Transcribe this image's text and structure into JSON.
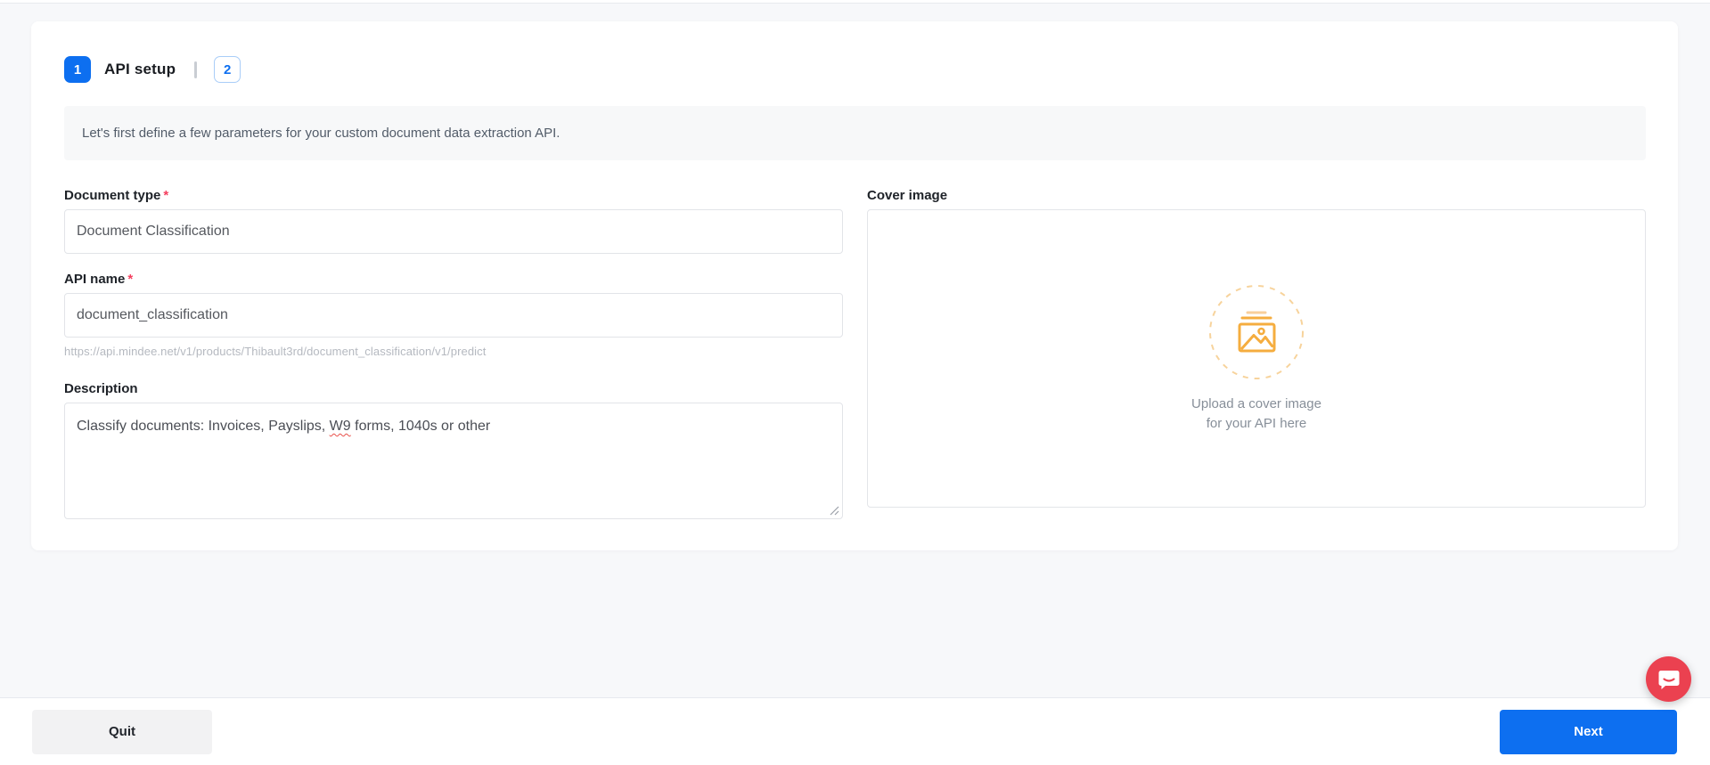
{
  "colors": {
    "accent_blue": "#0d6ff0",
    "step2_border_blue": "#a9cdf8",
    "required_red": "#f43f5e",
    "chat_red": "#eb4150",
    "upload_icon_orange": "#f5ad3f",
    "upload_ring_orange": "#f7d39c",
    "page_background": "#f7f8fa",
    "banner_background": "#f7f8f9"
  },
  "steps": {
    "step1_number": "1",
    "step1_label": "API setup",
    "step2_number": "2"
  },
  "banner": {
    "text": "Let's first define a few parameters for your custom document data extraction API."
  },
  "form": {
    "document_type": {
      "label": "Document type",
      "required_mark": "*",
      "value": "Document Classification"
    },
    "api_name": {
      "label": "API name",
      "required_mark": "*",
      "value": "document_classification",
      "url_hint": "https://api.mindee.net/v1/products/Thibault3rd/document_classification/v1/predict"
    },
    "description": {
      "label": "Description",
      "value_prefix": "Classify documents: Invoices, Payslips, ",
      "value_misspelled_word": "W9",
      "value_suffix": " forms, 1040s or other"
    }
  },
  "cover": {
    "label": "Cover image",
    "upload_line1": "Upload a cover image",
    "upload_line2": "for your API here",
    "icon": "image-upload-icon"
  },
  "footer": {
    "quit_label": "Quit",
    "next_label": "Next"
  },
  "chat": {
    "icon": "chat-messenger-icon"
  }
}
